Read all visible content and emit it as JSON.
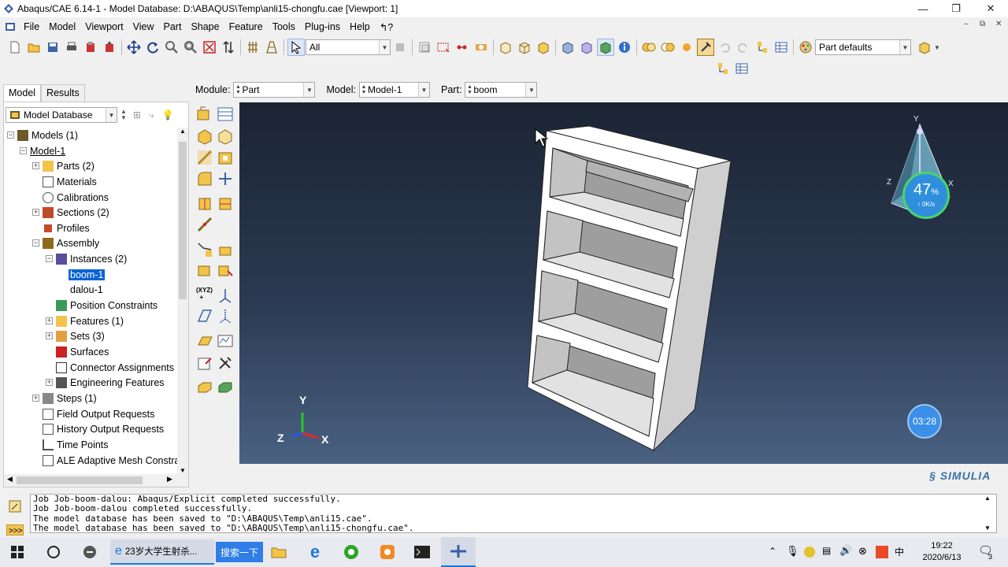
{
  "window": {
    "title": "Abaqus/CAE 6.14-1 - Model Database: D:\\ABAQUS\\Temp\\anli15-chongfu.cae [Viewport: 1]",
    "minimize": "—",
    "maximize": "❐",
    "close": "✕"
  },
  "menubar": {
    "items": [
      "File",
      "Model",
      "Viewport",
      "View",
      "Part",
      "Shape",
      "Feature",
      "Tools",
      "Plug-ins",
      "Help"
    ],
    "help_arrow": "↰?",
    "mdi_min": "–",
    "mdi_restore": "⧉",
    "mdi_close": "✕"
  },
  "toolbar": {
    "selection_filter": "All",
    "render_style": "Part defaults"
  },
  "context": {
    "module_label": "Module:",
    "module_value": "Part",
    "model_label": "Model:",
    "model_value": "Model-1",
    "part_label": "Part:",
    "part_value": "boom"
  },
  "tabs": {
    "model": "Model",
    "results": "Results"
  },
  "tree": {
    "header": "Model Database",
    "rows": [
      {
        "label": "Models (1)",
        "icon": "models-icon"
      },
      {
        "label": "Model-1",
        "icon": ""
      },
      {
        "label": "Parts (2)",
        "icon": "parts-icon"
      },
      {
        "label": "Materials",
        "icon": "materials-icon"
      },
      {
        "label": "Calibrations",
        "icon": "calibrations-icon"
      },
      {
        "label": "Sections (2)",
        "icon": "sections-icon"
      },
      {
        "label": "Profiles",
        "icon": "profiles-icon"
      },
      {
        "label": "Assembly",
        "icon": "assembly-icon"
      },
      {
        "label": "Instances (2)",
        "icon": "instances-icon"
      },
      {
        "label": "boom-1",
        "icon": ""
      },
      {
        "label": "dalou-1",
        "icon": ""
      },
      {
        "label": "Position Constraints",
        "icon": "constraints-icon"
      },
      {
        "label": "Features (1)",
        "icon": "features-icon"
      },
      {
        "label": "Sets (3)",
        "icon": "sets-icon"
      },
      {
        "label": "Surfaces",
        "icon": "surfaces-icon"
      },
      {
        "label": "Connector Assignments",
        "icon": "connector-icon"
      },
      {
        "label": "Engineering Features",
        "icon": "engineering-icon"
      },
      {
        "label": "Steps (1)",
        "icon": "steps-icon"
      },
      {
        "label": "Field Output Requests",
        "icon": "field-output-icon"
      },
      {
        "label": "History Output Requests",
        "icon": "history-output-icon"
      },
      {
        "label": "Time Points",
        "icon": "time-points-icon"
      },
      {
        "label": "ALE Adaptive Mesh Constra",
        "icon": "ale-icon"
      }
    ]
  },
  "viewport": {
    "triad_y": "Y",
    "triad_x": "X",
    "triad_z": "Z",
    "view_y": "Y",
    "view_x": "X",
    "view_z": "Z",
    "brand": "SIMULIA",
    "timer": "03:28",
    "netmon_pct": "47",
    "netmon_unit": "%",
    "netmon_speed": "↑ 0K/s"
  },
  "messages": [
    "Job Job-boom-dalou: Abaqus/Explicit completed successfully.",
    "Job Job-boom-dalou completed successfully.",
    "The model database has been saved to \"D:\\ABAQUS\\Temp\\anli15.cae\".",
    "The model database has been saved to \"D:\\ABAQUS\\Temp\\anli15-chongfu.cae\"."
  ],
  "taskbar": {
    "task_label": "23岁大学生射杀...",
    "search_label": "搜索一下",
    "time": "19:22",
    "date": "2020/6/13",
    "notif_count": "3"
  },
  "colors": {
    "accent": "#0a64d6",
    "viewport_top": "#1b2433",
    "viewport_bottom": "#4a6182",
    "shelf": "#ffffff",
    "shelf_shade": "#c9c9c9"
  }
}
